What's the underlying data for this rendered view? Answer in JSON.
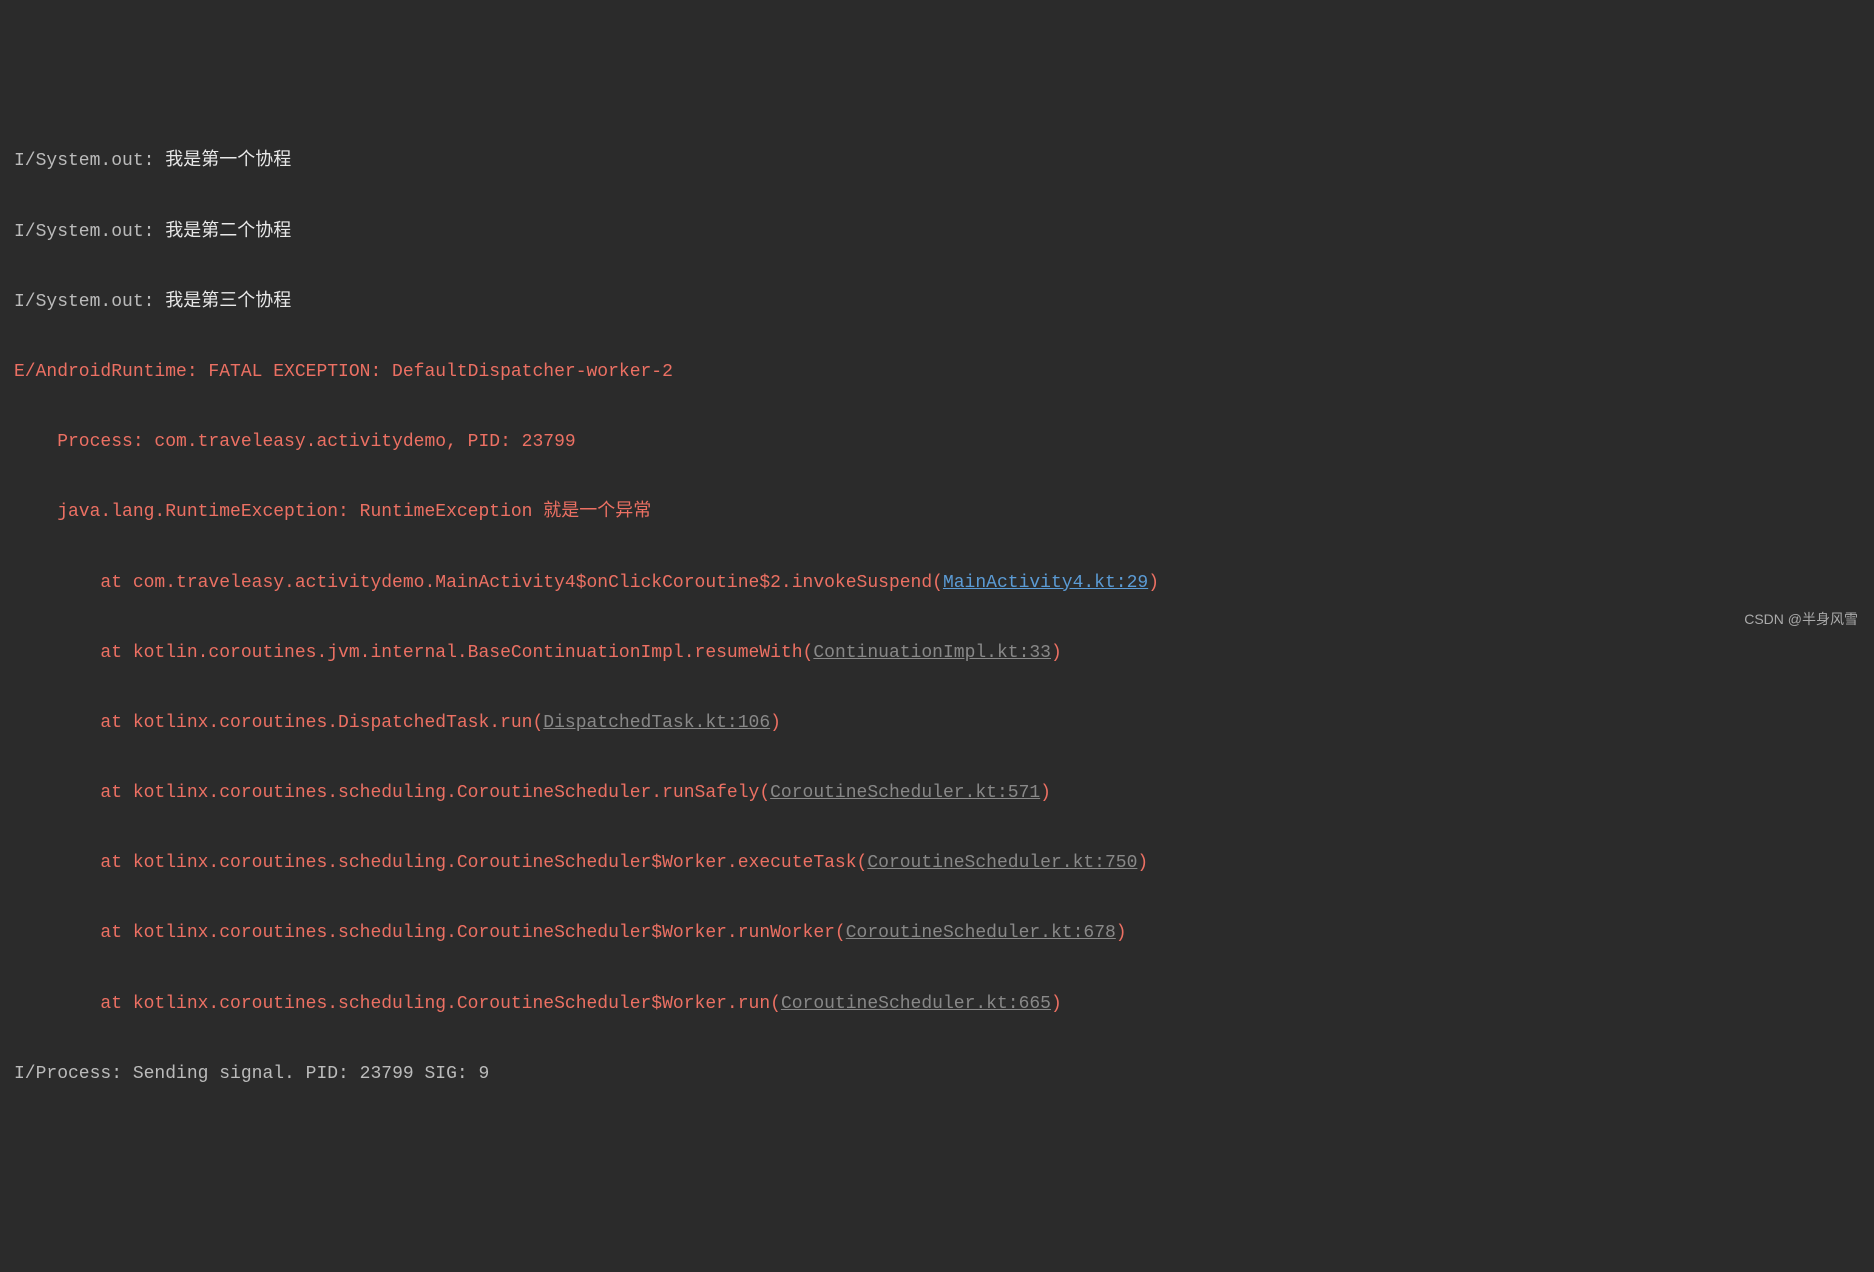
{
  "lines": [
    {
      "type": "info",
      "tag": "I/System.out: ",
      "msg": "我是第一个协程"
    },
    {
      "type": "info",
      "tag": "I/System.out: ",
      "msg": "我是第二个协程"
    },
    {
      "type": "info",
      "tag": "I/System.out: ",
      "msg": "我是第三个协程"
    }
  ],
  "error": {
    "header": "E/AndroidRuntime: FATAL EXCEPTION: DefaultDispatcher-worker-2",
    "process": "    Process: com.traveleasy.activitydemo, PID: 23799",
    "exception": "    java.lang.RuntimeException: RuntimeException 就是一个异常",
    "stack": [
      {
        "prefix": "        at com.traveleasy.activitydemo.MainActivity4$onClickCoroutine$2.invokeSuspend(",
        "link": "MainActivity4.kt:29",
        "linkType": "blue",
        "suffix": ")"
      },
      {
        "prefix": "        at kotlin.coroutines.jvm.internal.BaseContinuationImpl.resumeWith(",
        "link": "ContinuationImpl.kt:33",
        "linkType": "gray",
        "suffix": ")"
      },
      {
        "prefix": "        at kotlinx.coroutines.DispatchedTask.run(",
        "link": "DispatchedTask.kt:106",
        "linkType": "gray",
        "suffix": ")"
      },
      {
        "prefix": "        at kotlinx.coroutines.scheduling.CoroutineScheduler.runSafely(",
        "link": "CoroutineScheduler.kt:571",
        "linkType": "gray",
        "suffix": ")"
      },
      {
        "prefix": "        at kotlinx.coroutines.scheduling.CoroutineScheduler$Worker.executeTask(",
        "link": "CoroutineScheduler.kt:750",
        "linkType": "gray",
        "suffix": ")"
      },
      {
        "prefix": "        at kotlinx.coroutines.scheduling.CoroutineScheduler$Worker.runWorker(",
        "link": "CoroutineScheduler.kt:678",
        "linkType": "gray",
        "suffix": ")"
      },
      {
        "prefix": "        at kotlinx.coroutines.scheduling.CoroutineScheduler$Worker.run(",
        "link": "CoroutineScheduler.kt:665",
        "linkType": "gray",
        "suffix": ")"
      }
    ]
  },
  "footer": {
    "tag": "I/Process: ",
    "msg": "Sending signal. PID: 23799 SIG: 9"
  },
  "watermark": "CSDN @半身风雪"
}
